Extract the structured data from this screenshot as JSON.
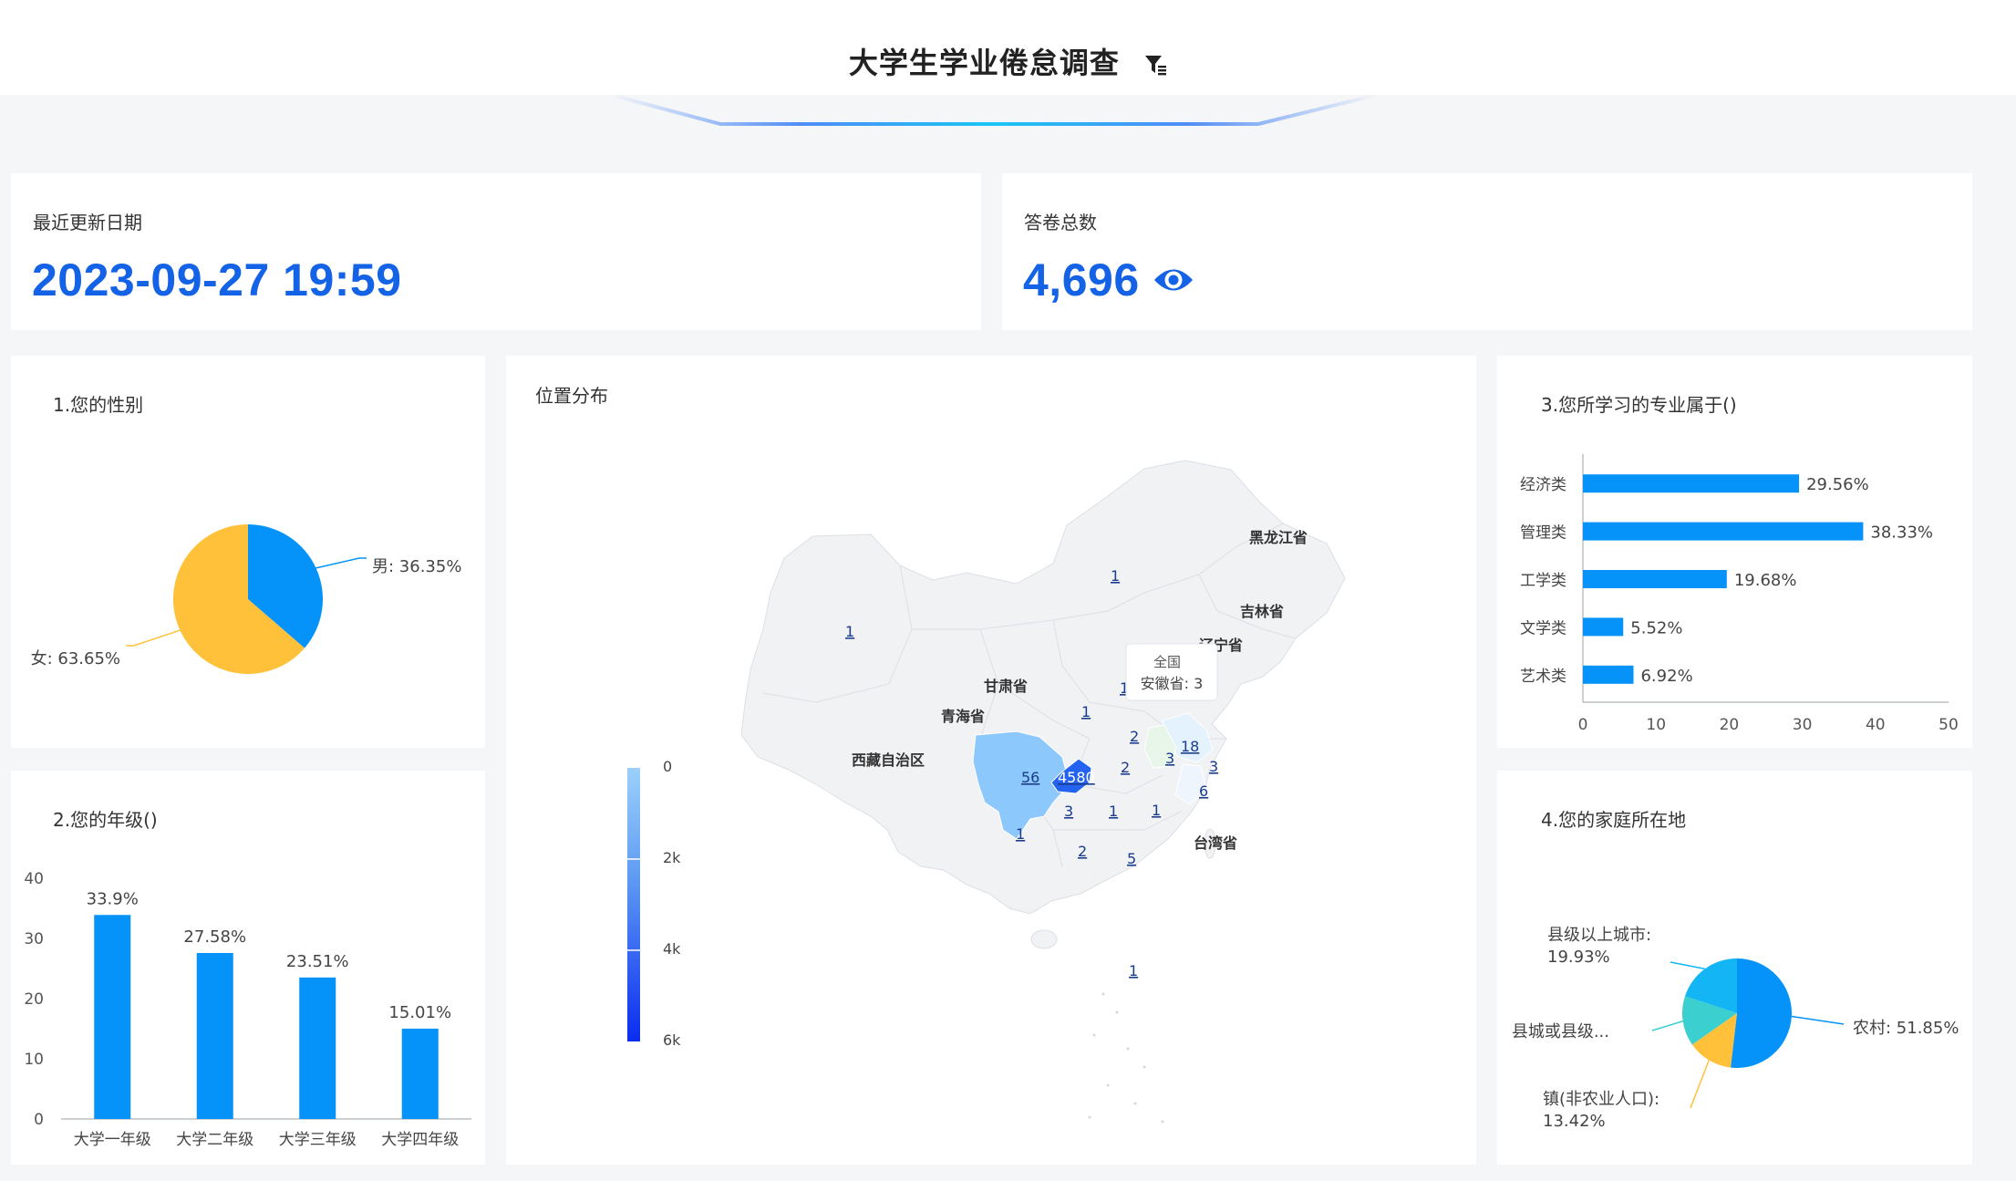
{
  "header": {
    "title": "大学生学业倦怠调查"
  },
  "kpi_updated": {
    "label": "最近更新日期",
    "value": "2023-09-27 19:59"
  },
  "kpi_total": {
    "label": "答卷总数",
    "value": "4,696"
  },
  "gender": {
    "title": "1.您的性别",
    "chart_data": {
      "type": "pie",
      "title": "1.您的性别",
      "slices": [
        {
          "name": "男",
          "value": 36.35,
          "label": "男: 36.35%",
          "color": "#0593fa"
        },
        {
          "name": "女",
          "value": 63.65,
          "label": "女: 63.65%",
          "color": "#ffc13a"
        }
      ]
    }
  },
  "grade": {
    "title": "2.您的年级()",
    "chart_data": {
      "type": "bar",
      "title": "2.您的年级()",
      "categories": [
        "大学一年级",
        "大学二年级",
        "大学三年级",
        "大学四年级"
      ],
      "values": [
        33.9,
        27.58,
        23.51,
        15.01
      ],
      "labels": [
        "33.9%",
        "27.58%",
        "23.51%",
        "15.01%"
      ],
      "yticks": [
        "0",
        "10",
        "20",
        "30",
        "40"
      ],
      "ylim": [
        0,
        40
      ],
      "color": "#0593fa"
    }
  },
  "map": {
    "title": "位置分布",
    "legend_ticks": [
      "0",
      "2k",
      "4k",
      "6k"
    ],
    "province_labels": [
      "黑龙江省",
      "吉林省",
      "辽宁省",
      "甘肃省",
      "青海省",
      "西藏自治区",
      "台湾省"
    ],
    "values": [
      "1",
      "1",
      "56",
      "4580",
      "18",
      "2",
      "3",
      "3",
      "6",
      "3",
      "1",
      "1",
      "1",
      "2",
      "5",
      "1",
      "1",
      "2",
      "1"
    ],
    "tooltip": {
      "title": "全国",
      "text": "安徽省: 3"
    }
  },
  "major": {
    "title": "3.您所学习的专业属于()",
    "chart_data": {
      "type": "bar",
      "orientation": "horizontal",
      "title": "3.您所学习的专业属于()",
      "categories": [
        "经济类",
        "管理类",
        "工学类",
        "文学类",
        "艺术类"
      ],
      "values": [
        29.56,
        38.33,
        19.68,
        5.52,
        6.92
      ],
      "labels": [
        "29.56%",
        "38.33%",
        "19.68%",
        "5.52%",
        "6.92%"
      ],
      "xticks": [
        "0",
        "10",
        "20",
        "30",
        "40",
        "50"
      ],
      "xlim": [
        0,
        50
      ],
      "color": "#0593fa"
    }
  },
  "home": {
    "title": "4.您的家庭所在地",
    "chart_data": {
      "type": "pie",
      "title": "4.您的家庭所在地",
      "slices": [
        {
          "name": "农村",
          "value": 51.85,
          "label_lines": [
            "农村: 51.85%"
          ],
          "color": "#0593fa"
        },
        {
          "name": "镇(非农业人口)",
          "value": 13.42,
          "label_lines": [
            "镇(非农业人口):",
            "13.42%"
          ],
          "color": "#ffc13a"
        },
        {
          "name": "县城或县级...",
          "value": 14.8,
          "label_lines": [
            "县城或县级..."
          ],
          "color": "#3ccfcf"
        },
        {
          "name": "县级以上城市",
          "value": 19.93,
          "label_lines": [
            "县级以上城市:",
            "19.93%"
          ],
          "color": "#13b5f5"
        }
      ]
    }
  }
}
